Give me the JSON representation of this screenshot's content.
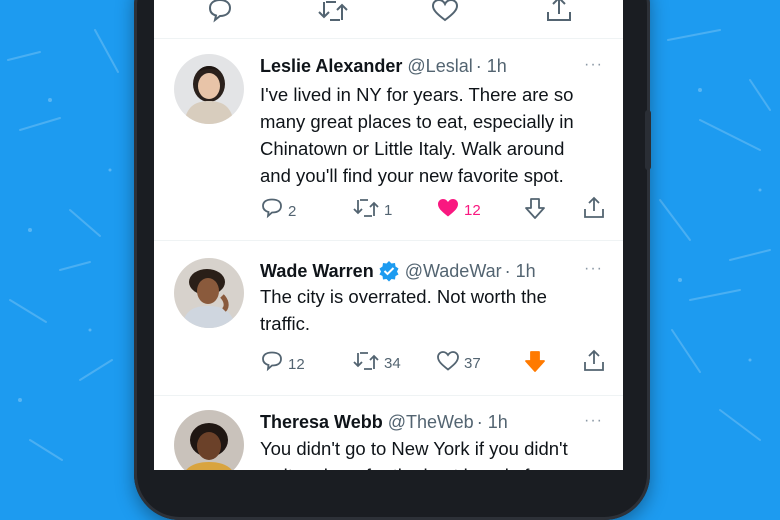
{
  "tweets": [
    {
      "name": "Leslie Alexander",
      "handle": "@Leslal",
      "time": "· 1h",
      "more": "···",
      "text": "I've lived in NY for years. There are so many great places to eat, especially in Chinatown or Little Italy. Walk around and you'll find your new favorite spot.",
      "replies": "2",
      "retweets": "1",
      "likes": "12"
    },
    {
      "name": "Wade Warren",
      "handle": "@WadeWar",
      "time": "· 1h",
      "more": "···",
      "text": "The city is overrated. Not worth the traffic.",
      "replies": "12",
      "retweets": "34",
      "likes": "37"
    },
    {
      "name": "Theresa Webb",
      "handle": "@TheWeb",
      "time": "· 1h",
      "more": "···",
      "text": "You didn't go to New York if you didn't wait an hour for the best bagel of your"
    }
  ],
  "colors": {
    "background": "#1d9bf0",
    "like_active": "#f91880",
    "downvote_active": "#ff7a00",
    "verified": "#1d9bf0"
  },
  "icons": [
    "reply-icon",
    "retweet-icon",
    "like-icon",
    "downvote-icon",
    "share-icon",
    "verified-badge-icon"
  ]
}
